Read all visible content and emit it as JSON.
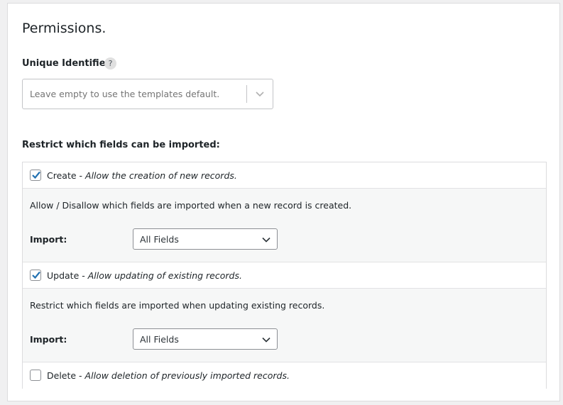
{
  "panel": {
    "title": "Permissions."
  },
  "unique_identifier": {
    "label": "Unique Identifier:",
    "help_icon": "?",
    "placeholder": "Leave empty to use the templates default."
  },
  "restrict": {
    "label": "Restrict which fields can be imported:"
  },
  "permissions": {
    "create": {
      "checked": true,
      "name": "Create",
      "separator": " - ",
      "description": "Allow the creation of new records.",
      "detail": "Allow / Disallow which fields are imported when a new record is created.",
      "import_label": "Import:",
      "import_value": "All Fields"
    },
    "update": {
      "checked": true,
      "name": "Update",
      "separator": " - ",
      "description": "Allow updating of existing records.",
      "detail": "Restrict which fields are imported when updating existing records.",
      "import_label": "Import:",
      "import_value": "All Fields"
    },
    "delete": {
      "checked": false,
      "name": "Delete",
      "separator": " - ",
      "description": "Allow deletion of previously imported records."
    }
  },
  "colors": {
    "check_blue": "#2271b1",
    "border": "#dcdcde",
    "row_alt": "#f6f7f7"
  },
  "icons": {
    "help": "question-circle-icon",
    "dropdown": "chevron-down-icon",
    "checked": "checkmark-icon"
  }
}
